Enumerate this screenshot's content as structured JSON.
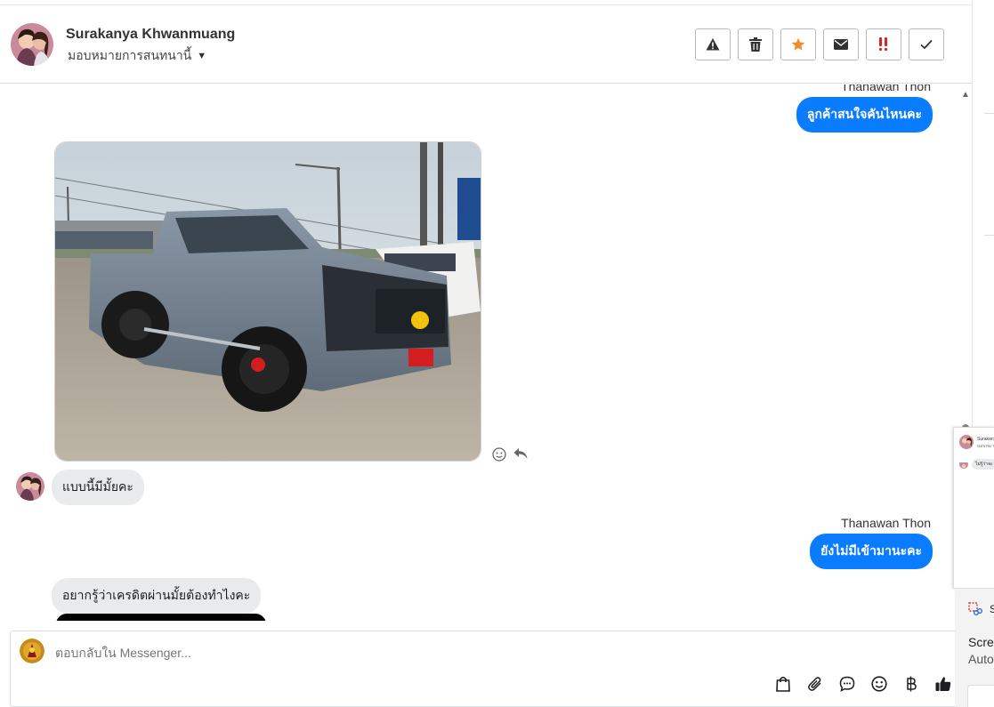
{
  "header": {
    "contact_name": "Surakanya Khwanmuang",
    "assign_label": "มอบหมายการสนทนานี้",
    "actions": [
      {
        "icon": "warning-icon",
        "color": "#333333"
      },
      {
        "icon": "trash-icon",
        "color": "#333333"
      },
      {
        "icon": "star-icon",
        "color": "#f28c28"
      },
      {
        "icon": "envelope-icon",
        "color": "#333333"
      },
      {
        "icon": "double-exclamation-icon",
        "color": "#e02020"
      },
      {
        "icon": "check-icon",
        "color": "#333333"
      }
    ]
  },
  "conversation": {
    "messages": [
      {
        "sender": "Thanawan Thon",
        "text": "ลูกค้าสนใจคันไหนคะ",
        "direction": "outgoing"
      },
      {
        "type": "image",
        "direction": "incoming",
        "alt": "pickup truck photo"
      },
      {
        "text": "แบบนี้มีมั้ยคะ",
        "direction": "incoming"
      },
      {
        "sender": "Thanawan Thon",
        "text": "ยังไม่มีเข้ามานะคะ",
        "direction": "outgoing"
      },
      {
        "text": "อยากรู้ว่าเครดิตผ่านมั้ยต้องทำไงคะ",
        "direction": "incoming"
      }
    ]
  },
  "composer": {
    "placeholder": "ตอบกลับใน Messenger...",
    "tools": [
      "bag-icon",
      "paperclip-icon",
      "chat-bubble-icon",
      "smiley-icon",
      "baht-icon",
      "thumbs-up-icon"
    ]
  },
  "mini_window": {
    "name": "Surakan",
    "sub": "มอบหมา",
    "bubble": "ไม่รู้ว่าจะ"
  },
  "snipping_panel": {
    "title": "Sn",
    "line1": "Scree",
    "line2": "Auto"
  },
  "colors": {
    "accent": "#0a7cff",
    "incoming_bubble": "#e9eaeb"
  }
}
